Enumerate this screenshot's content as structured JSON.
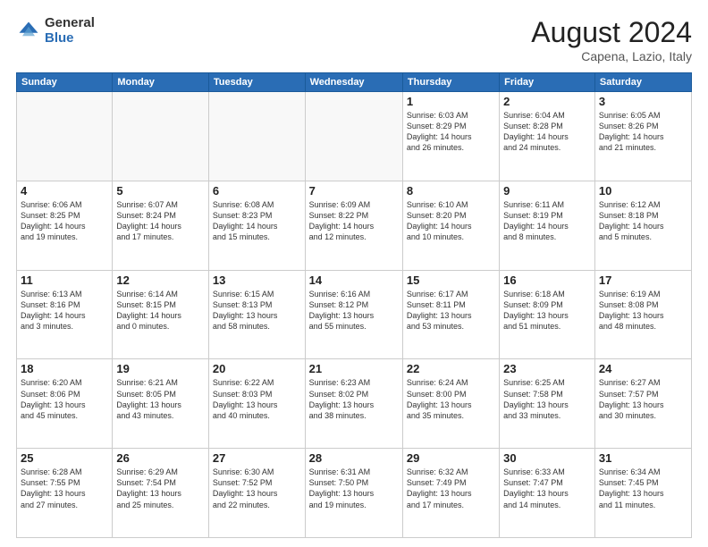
{
  "logo": {
    "general": "General",
    "blue": "Blue"
  },
  "header": {
    "month_year": "August 2024",
    "location": "Capena, Lazio, Italy"
  },
  "weekdays": [
    "Sunday",
    "Monday",
    "Tuesday",
    "Wednesday",
    "Thursday",
    "Friday",
    "Saturday"
  ],
  "weeks": [
    [
      {
        "day": "",
        "info": ""
      },
      {
        "day": "",
        "info": ""
      },
      {
        "day": "",
        "info": ""
      },
      {
        "day": "",
        "info": ""
      },
      {
        "day": "1",
        "info": "Sunrise: 6:03 AM\nSunset: 8:29 PM\nDaylight: 14 hours\nand 26 minutes."
      },
      {
        "day": "2",
        "info": "Sunrise: 6:04 AM\nSunset: 8:28 PM\nDaylight: 14 hours\nand 24 minutes."
      },
      {
        "day": "3",
        "info": "Sunrise: 6:05 AM\nSunset: 8:26 PM\nDaylight: 14 hours\nand 21 minutes."
      }
    ],
    [
      {
        "day": "4",
        "info": "Sunrise: 6:06 AM\nSunset: 8:25 PM\nDaylight: 14 hours\nand 19 minutes."
      },
      {
        "day": "5",
        "info": "Sunrise: 6:07 AM\nSunset: 8:24 PM\nDaylight: 14 hours\nand 17 minutes."
      },
      {
        "day": "6",
        "info": "Sunrise: 6:08 AM\nSunset: 8:23 PM\nDaylight: 14 hours\nand 15 minutes."
      },
      {
        "day": "7",
        "info": "Sunrise: 6:09 AM\nSunset: 8:22 PM\nDaylight: 14 hours\nand 12 minutes."
      },
      {
        "day": "8",
        "info": "Sunrise: 6:10 AM\nSunset: 8:20 PM\nDaylight: 14 hours\nand 10 minutes."
      },
      {
        "day": "9",
        "info": "Sunrise: 6:11 AM\nSunset: 8:19 PM\nDaylight: 14 hours\nand 8 minutes."
      },
      {
        "day": "10",
        "info": "Sunrise: 6:12 AM\nSunset: 8:18 PM\nDaylight: 14 hours\nand 5 minutes."
      }
    ],
    [
      {
        "day": "11",
        "info": "Sunrise: 6:13 AM\nSunset: 8:16 PM\nDaylight: 14 hours\nand 3 minutes."
      },
      {
        "day": "12",
        "info": "Sunrise: 6:14 AM\nSunset: 8:15 PM\nDaylight: 14 hours\nand 0 minutes."
      },
      {
        "day": "13",
        "info": "Sunrise: 6:15 AM\nSunset: 8:13 PM\nDaylight: 13 hours\nand 58 minutes."
      },
      {
        "day": "14",
        "info": "Sunrise: 6:16 AM\nSunset: 8:12 PM\nDaylight: 13 hours\nand 55 minutes."
      },
      {
        "day": "15",
        "info": "Sunrise: 6:17 AM\nSunset: 8:11 PM\nDaylight: 13 hours\nand 53 minutes."
      },
      {
        "day": "16",
        "info": "Sunrise: 6:18 AM\nSunset: 8:09 PM\nDaylight: 13 hours\nand 51 minutes."
      },
      {
        "day": "17",
        "info": "Sunrise: 6:19 AM\nSunset: 8:08 PM\nDaylight: 13 hours\nand 48 minutes."
      }
    ],
    [
      {
        "day": "18",
        "info": "Sunrise: 6:20 AM\nSunset: 8:06 PM\nDaylight: 13 hours\nand 45 minutes."
      },
      {
        "day": "19",
        "info": "Sunrise: 6:21 AM\nSunset: 8:05 PM\nDaylight: 13 hours\nand 43 minutes."
      },
      {
        "day": "20",
        "info": "Sunrise: 6:22 AM\nSunset: 8:03 PM\nDaylight: 13 hours\nand 40 minutes."
      },
      {
        "day": "21",
        "info": "Sunrise: 6:23 AM\nSunset: 8:02 PM\nDaylight: 13 hours\nand 38 minutes."
      },
      {
        "day": "22",
        "info": "Sunrise: 6:24 AM\nSunset: 8:00 PM\nDaylight: 13 hours\nand 35 minutes."
      },
      {
        "day": "23",
        "info": "Sunrise: 6:25 AM\nSunset: 7:58 PM\nDaylight: 13 hours\nand 33 minutes."
      },
      {
        "day": "24",
        "info": "Sunrise: 6:27 AM\nSunset: 7:57 PM\nDaylight: 13 hours\nand 30 minutes."
      }
    ],
    [
      {
        "day": "25",
        "info": "Sunrise: 6:28 AM\nSunset: 7:55 PM\nDaylight: 13 hours\nand 27 minutes."
      },
      {
        "day": "26",
        "info": "Sunrise: 6:29 AM\nSunset: 7:54 PM\nDaylight: 13 hours\nand 25 minutes."
      },
      {
        "day": "27",
        "info": "Sunrise: 6:30 AM\nSunset: 7:52 PM\nDaylight: 13 hours\nand 22 minutes."
      },
      {
        "day": "28",
        "info": "Sunrise: 6:31 AM\nSunset: 7:50 PM\nDaylight: 13 hours\nand 19 minutes."
      },
      {
        "day": "29",
        "info": "Sunrise: 6:32 AM\nSunset: 7:49 PM\nDaylight: 13 hours\nand 17 minutes."
      },
      {
        "day": "30",
        "info": "Sunrise: 6:33 AM\nSunset: 7:47 PM\nDaylight: 13 hours\nand 14 minutes."
      },
      {
        "day": "31",
        "info": "Sunrise: 6:34 AM\nSunset: 7:45 PM\nDaylight: 13 hours\nand 11 minutes."
      }
    ]
  ]
}
